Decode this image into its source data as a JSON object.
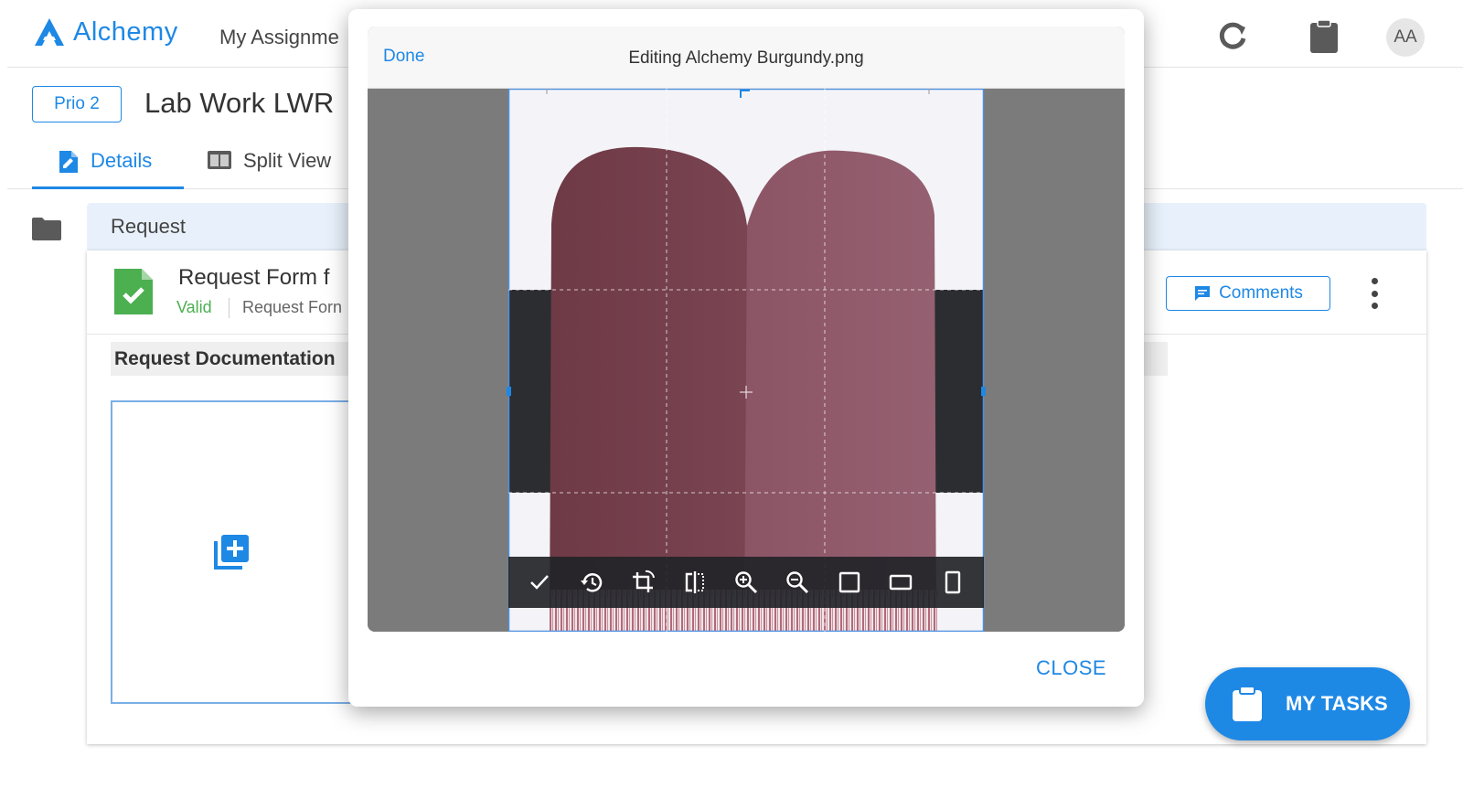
{
  "app": {
    "brand": "Alchemy",
    "nav_link": "My Assignme",
    "avatar_initials": "AA",
    "accent_color": "#1e88e5"
  },
  "header": {
    "priority": "Prio 2",
    "title": "Lab Work LWR",
    "tabs": [
      {
        "label": "Details",
        "active": true,
        "icon": "edit-document-icon"
      },
      {
        "label": "Split View",
        "active": false,
        "icon": "split-view-icon"
      }
    ]
  },
  "section": {
    "label": "Request"
  },
  "form": {
    "title": "Request Form f",
    "status": "Valid",
    "subtitle": "Request Forn",
    "comments_label": "Comments",
    "documentation_label": "Request Documentation"
  },
  "fab": {
    "label": "MY TASKS"
  },
  "modal": {
    "done_label": "Done",
    "title": "Editing Alchemy Burgundy.png",
    "close_label": "CLOSE",
    "toolbar": [
      {
        "name": "apply-crop-icon"
      },
      {
        "name": "reset-history-icon"
      },
      {
        "name": "rotate-crop-icon"
      },
      {
        "name": "flip-horizontal-icon"
      },
      {
        "name": "zoom-in-icon"
      },
      {
        "name": "zoom-out-icon"
      },
      {
        "name": "aspect-square-icon"
      },
      {
        "name": "aspect-landscape-icon"
      },
      {
        "name": "aspect-portrait-icon"
      }
    ]
  }
}
